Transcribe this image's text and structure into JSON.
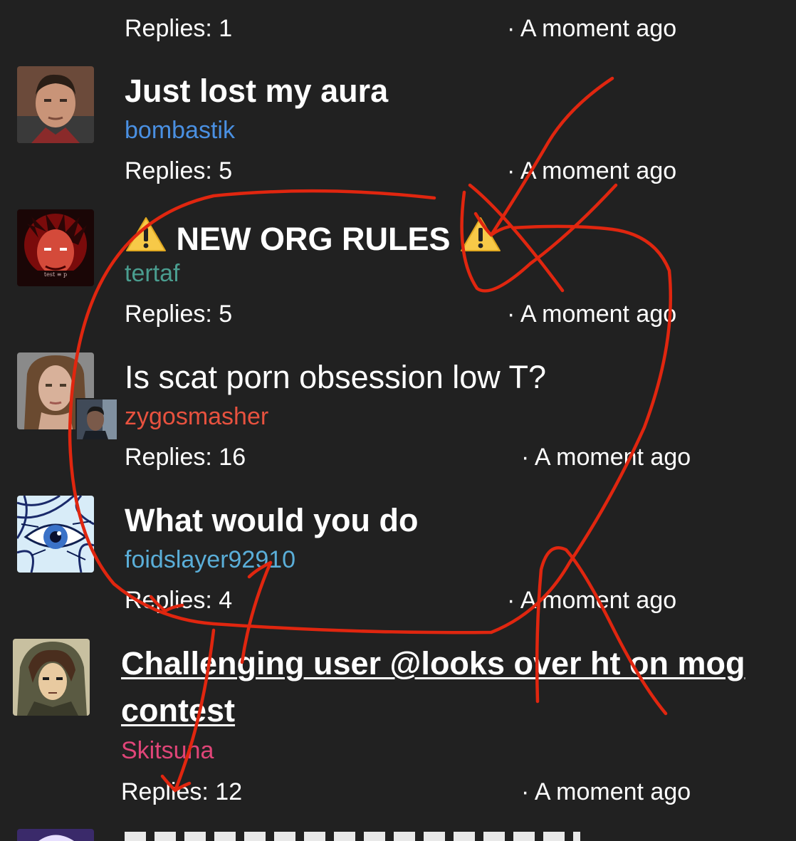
{
  "top_partial": {
    "replies_label": "Replies: 1",
    "time": "· A moment ago"
  },
  "threads": [
    {
      "title": "Just lost my aura",
      "username": "bombastik",
      "username_color": "#4a90e2",
      "replies_label": "Replies: 5",
      "time": "· A moment ago",
      "avatar_icon": "male-portrait-avatar"
    },
    {
      "title": "NEW ORG RULES",
      "title_prefix_icon": "warning-icon",
      "title_suffix_icon": "warning-icon",
      "username": "tertaf",
      "username_color": "#4a9d8f",
      "replies_label": "Replies: 5",
      "time": "· A moment ago",
      "avatar_icon": "red-demon-avatar"
    },
    {
      "title": "Is scat porn obsession low T?",
      "username": "zygosmasher",
      "username_color": "#e8523f",
      "replies_label": "Replies: 16",
      "time": "· A moment ago",
      "avatar_icon": "female-portrait-avatar",
      "badge_icon": "secondary-user-avatar"
    },
    {
      "title": "What would you do",
      "username": "foidslayer92910",
      "username_color": "#5aaed8",
      "replies_label": "Replies: 4",
      "time": "· A moment ago",
      "avatar_icon": "eye-drawing-avatar"
    },
    {
      "title_line1": "Challenging user @looks over ht on mog",
      "title_line2": "contest",
      "username": "Skitsuna",
      "username_color": "#e04578",
      "replies_label": "Replies: 12",
      "time": "· A moment ago",
      "avatar_icon": "anime-character-avatar"
    }
  ],
  "annotation": {
    "color": "#e0260f"
  }
}
